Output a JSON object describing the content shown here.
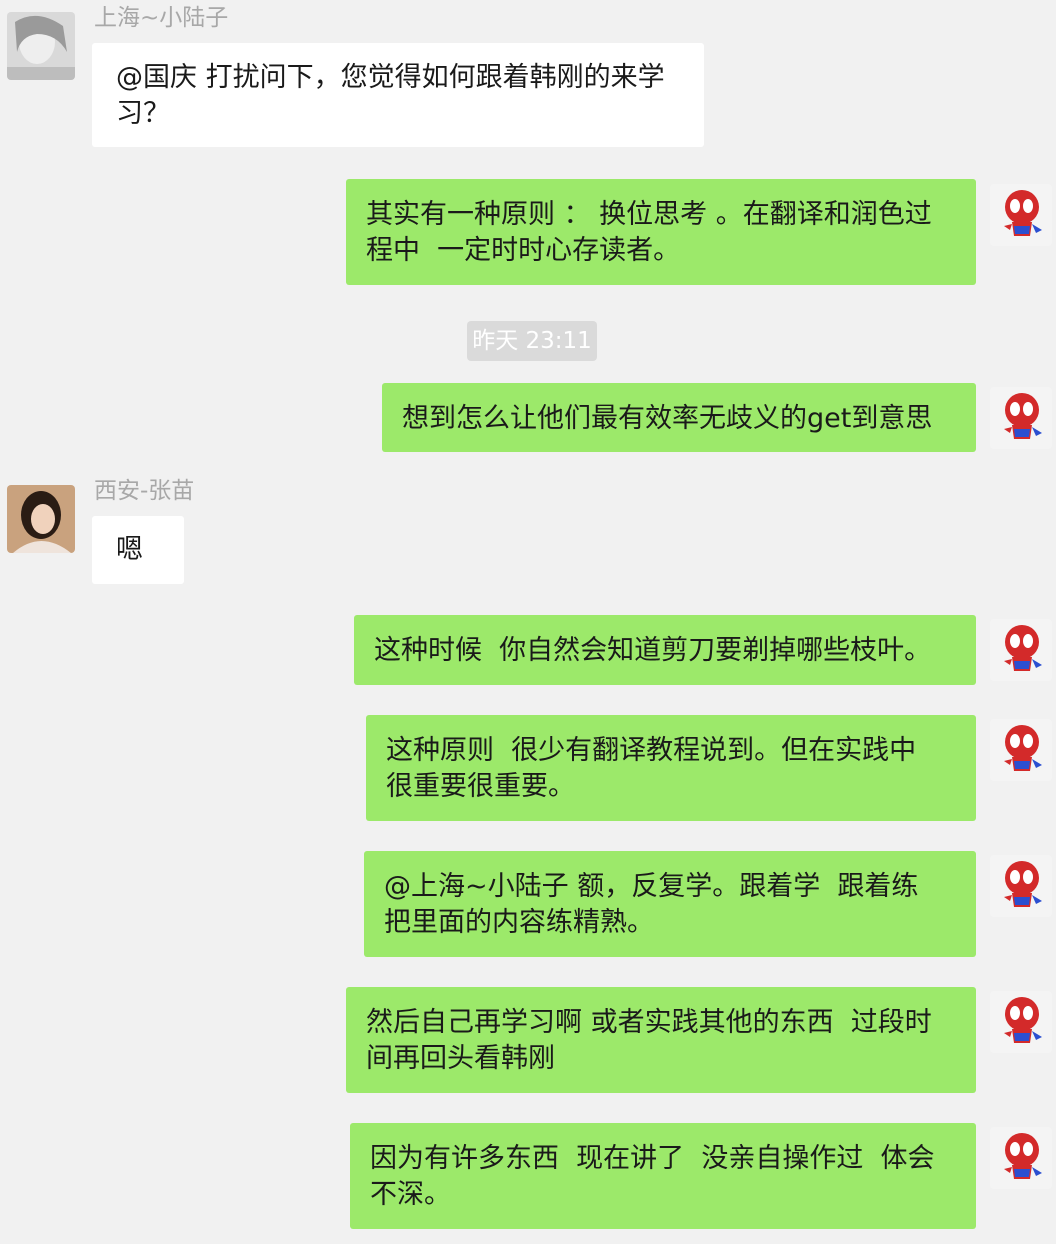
{
  "messages": [
    {
      "sender": "上海~小陆子",
      "text": "@国庆 打扰问下，您觉得如何跟着韩刚的来学\n习？"
    },
    {
      "text": "其实有一种原则 ： 换位思考 。在翻译和润色过\n程中  一定时时心存读者。"
    },
    {
      "time": "昨天 23:11"
    },
    {
      "text": "想到怎么让他们最有效率无歧义的get到意思"
    },
    {
      "sender": "西安-张苗",
      "text": "嗯"
    },
    {
      "text": "这种时候  你自然会知道剪刀要剃掉哪些枝叶。"
    },
    {
      "text": "这种原则  很少有翻译教程说到。但在实践中\n很重要很重要。"
    },
    {
      "text": "@上海~小陆子 额，反复学。跟着学  跟着练\n把里面的内容练精熟。"
    },
    {
      "text": "然后自己再学习啊 或者实践其他的东西  过段时\n间再回头看韩刚"
    },
    {
      "text": "因为有许多东西  现在讲了  没亲自操作过  体会\n不深。"
    }
  ],
  "colors": {
    "background": "#f1f1f1",
    "outgoing_bubble": "#9ce96a",
    "incoming_bubble": "#ffffff",
    "sender_name": "#a8a8a8"
  },
  "icons": {
    "self_avatar": "spiderman-avatar-icon",
    "contact1_avatar": "user-avatar-icon",
    "contact2_avatar": "user-avatar-icon"
  }
}
